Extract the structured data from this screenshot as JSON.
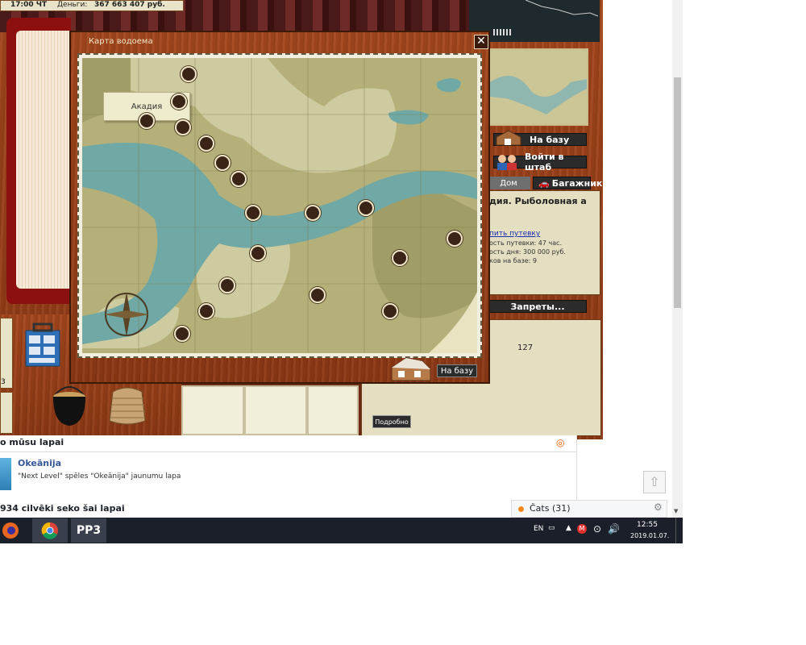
{
  "top_stats": {
    "time": "17:00 ЧТ",
    "money_label": "Деньги:",
    "money": "367 663 407 руб."
  },
  "dialog": {
    "title": "Карта водоема",
    "close_glyph": "✕",
    "location_label": "Акадия",
    "to_base_button": "На базу"
  },
  "right_panel": {
    "to_base": "На базу",
    "enter_hq": "Войти в штаб",
    "tab_home": "Дом",
    "tab_trunk": "Багажник",
    "info_title": "дия. Рыболовная а",
    "info_link": "пить путевку",
    "info_line1": "ость путевки: 47 час.",
    "info_line2": "ость дня: 300 000 руб.",
    "info_line3": "ков на базе: 9",
    "restrictions": "Запреты...",
    "counter": "127",
    "details_button": "Подробно",
    "left_number": "3"
  },
  "facebook": {
    "header": "o mūsu lapai",
    "page_name": "Okeānija",
    "description": "\"Next Level\" spēles \"Okeānija\" jaunumu lapa",
    "followers": "934 cilvēki seko šai lapai"
  },
  "chat": {
    "label": "Čats (31)"
  },
  "taskbar": {
    "apps": [
      "firefox-icon",
      "chrome-icon",
      "rr3-icon"
    ],
    "rr3_label": "РР3",
    "language": "EN",
    "time": "12:55",
    "date": "2019.01.07."
  },
  "colors": {
    "wood": "#a5471c",
    "map_land": "#a9a66d",
    "map_water": "#6fa8a4",
    "marker": "#3a2418"
  }
}
